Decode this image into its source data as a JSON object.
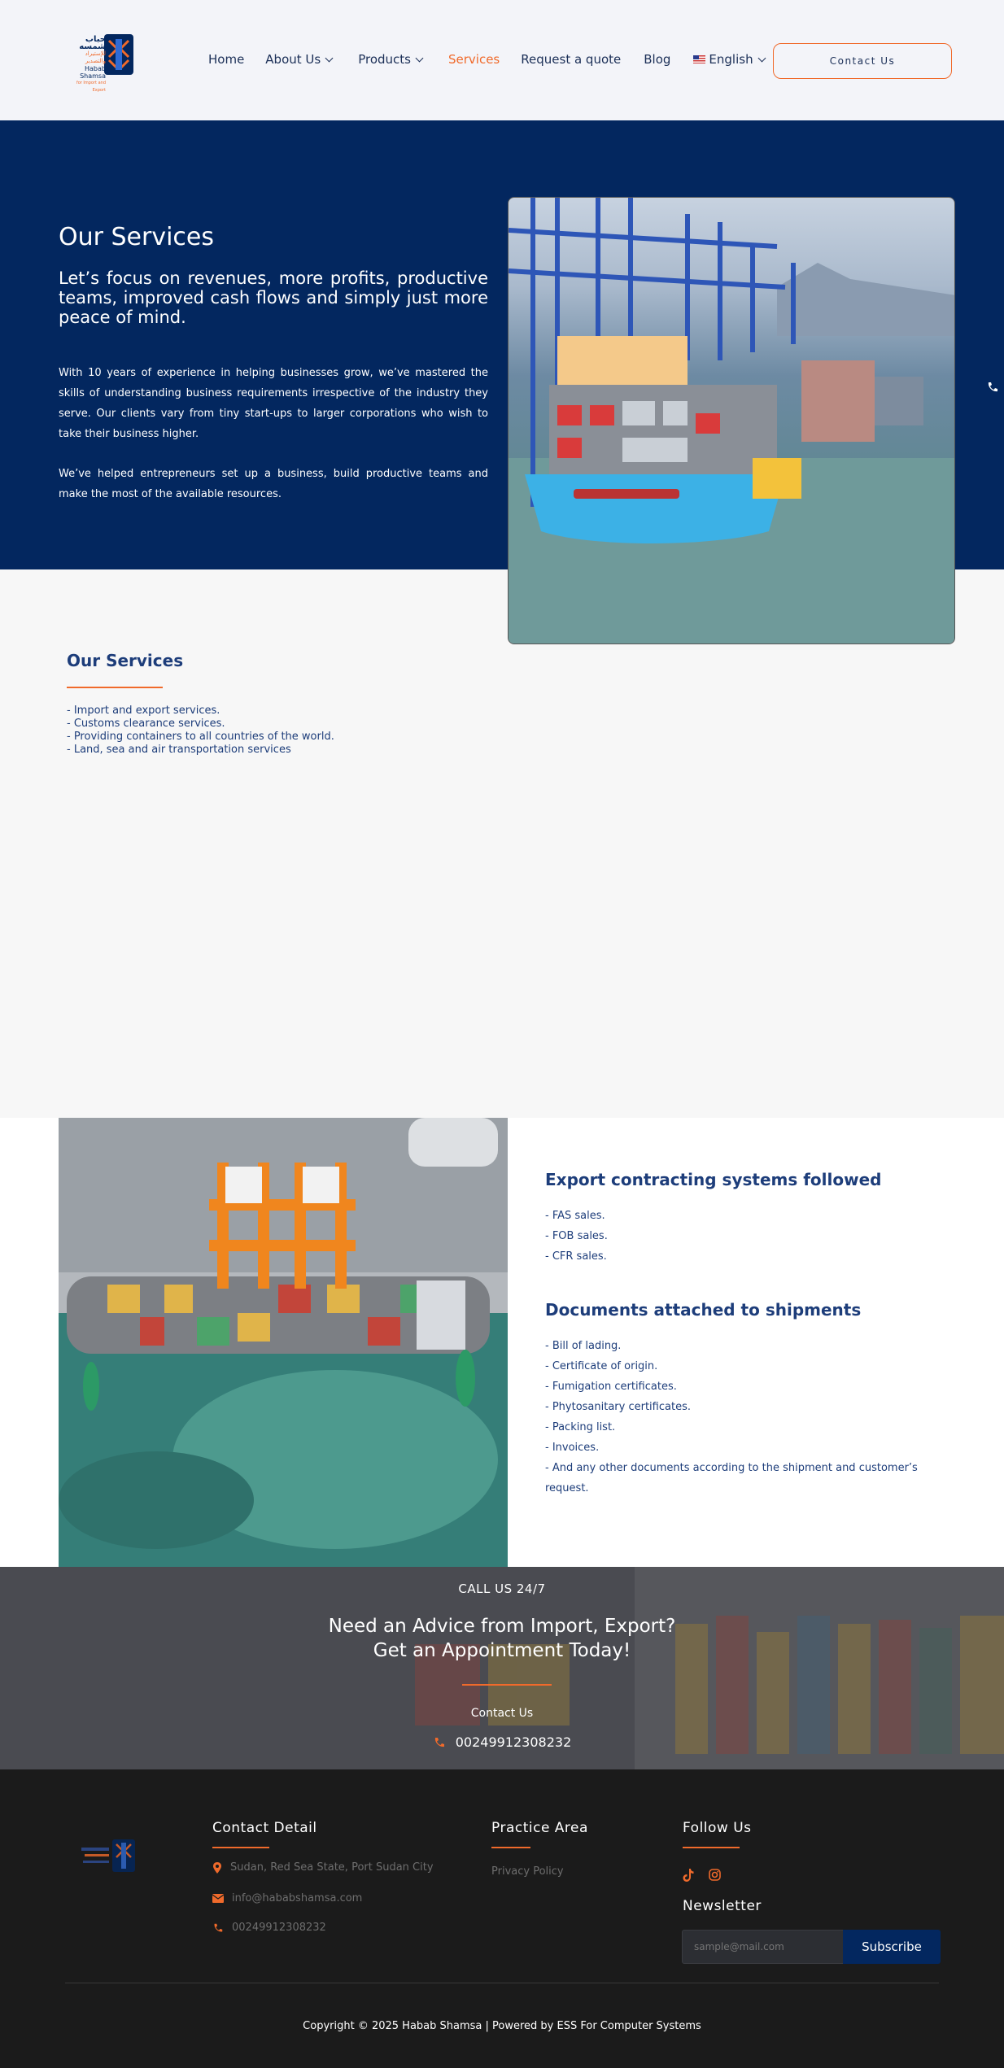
{
  "header": {
    "logo_ar": "حباب شمسه",
    "logo_ar2": "للإستيراد والتصدير",
    "logo_en": "Habab Shamsa",
    "logo_sub": "for Import and Export",
    "nav": [
      {
        "label": "Home"
      },
      {
        "label": "About Us"
      },
      {
        "label": "Products"
      },
      {
        "label": "Services"
      },
      {
        "label": "Request a quote"
      },
      {
        "label": "Blog"
      },
      {
        "label": "English"
      }
    ],
    "contact_button": "Contact Us"
  },
  "hero": {
    "title": "Our Services",
    "subtitle": "Let’s focus on revenues, more profits, productive teams, improved cash flows and simply just more peace of mind.",
    "paragraph1": "With 10 years of experience in helping businesses grow, we’ve mastered the skills of understanding business requirements irrespective of the industry they serve. Our clients vary from tiny start-ups to larger corporations who wish to take their business higher.",
    "paragraph2": "We’ve helped entrepreneurs set up a business, build productive teams and make the most of the available resources."
  },
  "services": {
    "title": "Our Services",
    "items": [
      "- Import and export services.",
      "- Customs clearance services.",
      "- Providing containers to all countries of the world.",
      "- Land, sea and air transportation services"
    ]
  },
  "export": {
    "title": "Export contracting systems followed",
    "items": [
      "- FAS sales.",
      "- FOB sales.",
      "- CFR sales."
    ]
  },
  "documents": {
    "title": "Documents attached to shipments",
    "items": [
      "- Bill of lading.",
      "- Certificate of origin.",
      "- Fumigation certificates.",
      "- Phytosanitary certificates.",
      "- Packing list.",
      "- Invoices.",
      "- And any other documents according to the shipment and customer’s request."
    ]
  },
  "cta": {
    "call": "CALL US 24/7",
    "headline1": "Need an Advice from Import, Export?",
    "headline2": "Get an Appointment Today!",
    "contact": "Contact Us",
    "phone": "00249912308232"
  },
  "footer": {
    "contact_title": "Contact Detail",
    "address": "Sudan, Red Sea State, Port Sudan City",
    "email": "info@hababshamsa.com",
    "phone": "00249912308232",
    "practice_title": "Practice Area",
    "privacy": "Privacy Policy",
    "follow_title": "Follow Us",
    "newsletter_title": "Newsletter",
    "newsletter_placeholder": "sample@mail.com",
    "subscribe": "Subscribe",
    "copyright": "Copyright © 2025 Habab Shamsa | Powered by ESS For Computer Systems"
  },
  "colors": {
    "navy": "#03275f",
    "accent": "#f06a2b",
    "footer_bg": "#1b1b1b"
  }
}
